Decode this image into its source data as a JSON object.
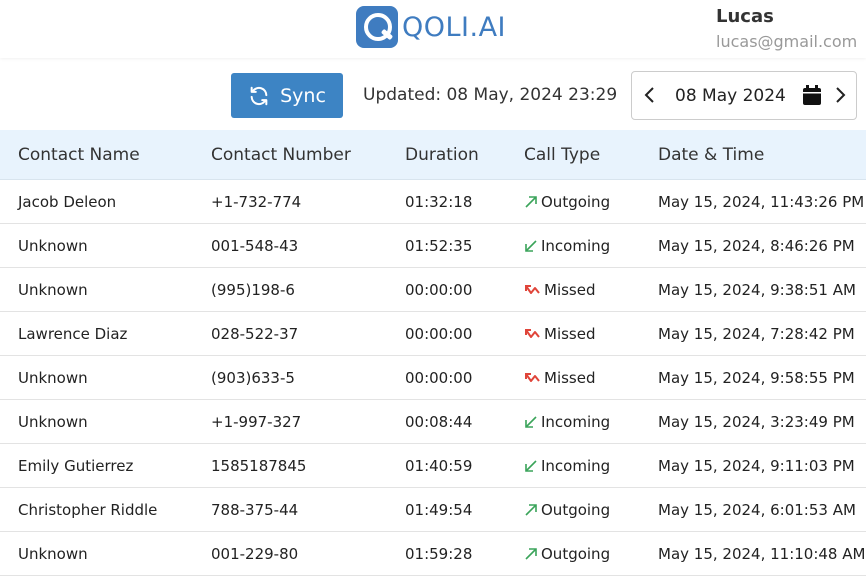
{
  "brand": {
    "name": "QOLI.AI",
    "color": "#3f7cc0"
  },
  "user": {
    "name": "Lucas",
    "email": "lucas@gmail.com"
  },
  "toolbar": {
    "sync_label": "Sync",
    "updated_text": "Updated: 08 May, 2024 23:29",
    "date_value": "08 May 2024"
  },
  "table": {
    "headers": [
      "Contact Name",
      "Contact Number",
      "Duration",
      "Call Type",
      "Date & Time"
    ],
    "rows": [
      {
        "name": "Jacob Deleon",
        "number": "+1-732-774",
        "duration": "01:32:18",
        "type": "Outgoing",
        "icon": "outgoing-arrow-icon",
        "datetime": "May 15, 2024, 11:43:26 PM"
      },
      {
        "name": "Unknown",
        "number": "001-548-43",
        "duration": "01:52:35",
        "type": "Incoming",
        "icon": "incoming-arrow-icon",
        "datetime": "May 15, 2024, 8:46:26 PM"
      },
      {
        "name": "Unknown",
        "number": "(995)198-6",
        "duration": "00:00:00",
        "type": "Missed",
        "icon": "missed-call-icon",
        "datetime": "May 15, 2024, 9:38:51 AM"
      },
      {
        "name": "Lawrence Diaz",
        "number": "028-522-37",
        "duration": "00:00:00",
        "type": "Missed",
        "icon": "missed-call-icon",
        "datetime": "May 15, 2024, 7:28:42 PM"
      },
      {
        "name": "Unknown",
        "number": "(903)633-5",
        "duration": "00:00:00",
        "type": "Missed",
        "icon": "missed-call-icon",
        "datetime": "May 15, 2024, 9:58:55 PM"
      },
      {
        "name": "Unknown",
        "number": "+1-997-327",
        "duration": "00:08:44",
        "type": "Incoming",
        "icon": "incoming-arrow-icon",
        "datetime": "May 15, 2024, 3:23:49 PM"
      },
      {
        "name": "Emily Gutierrez",
        "number": "1585187845",
        "duration": "01:40:59",
        "type": "Incoming",
        "icon": "incoming-arrow-icon",
        "datetime": "May 15, 2024, 9:11:03 PM"
      },
      {
        "name": "Christopher Riddle",
        "number": "788-375-44",
        "duration": "01:49:54",
        "type": "Outgoing",
        "icon": "outgoing-arrow-icon",
        "datetime": "May 15, 2024, 6:01:53 AM"
      },
      {
        "name": "Unknown",
        "number": "001-229-80",
        "duration": "01:59:28",
        "type": "Outgoing",
        "icon": "outgoing-arrow-icon",
        "datetime": "May 15, 2024, 11:10:48 AM"
      }
    ]
  },
  "colors": {
    "accent": "#3d84c4",
    "header_bg": "#e8f3fd",
    "incoming": "#3aa35a",
    "outgoing": "#3aa35a",
    "missed": "#e0453a"
  }
}
